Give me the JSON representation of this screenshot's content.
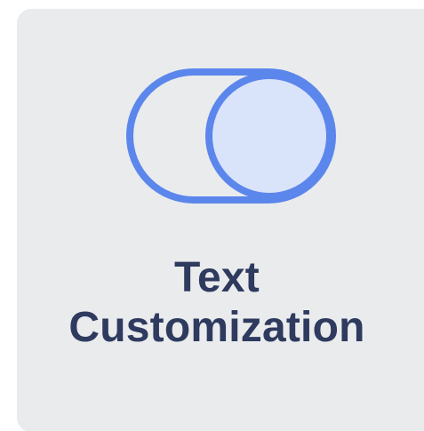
{
  "card": {
    "title_line1": "Text",
    "title_line2": "Customization",
    "icon": "toggle-switch-icon",
    "colors": {
      "background": "#e9ebed",
      "icon_stroke": "#5b86ec",
      "icon_fill": "#d9e4fb",
      "title": "#2e3a5e"
    }
  }
}
